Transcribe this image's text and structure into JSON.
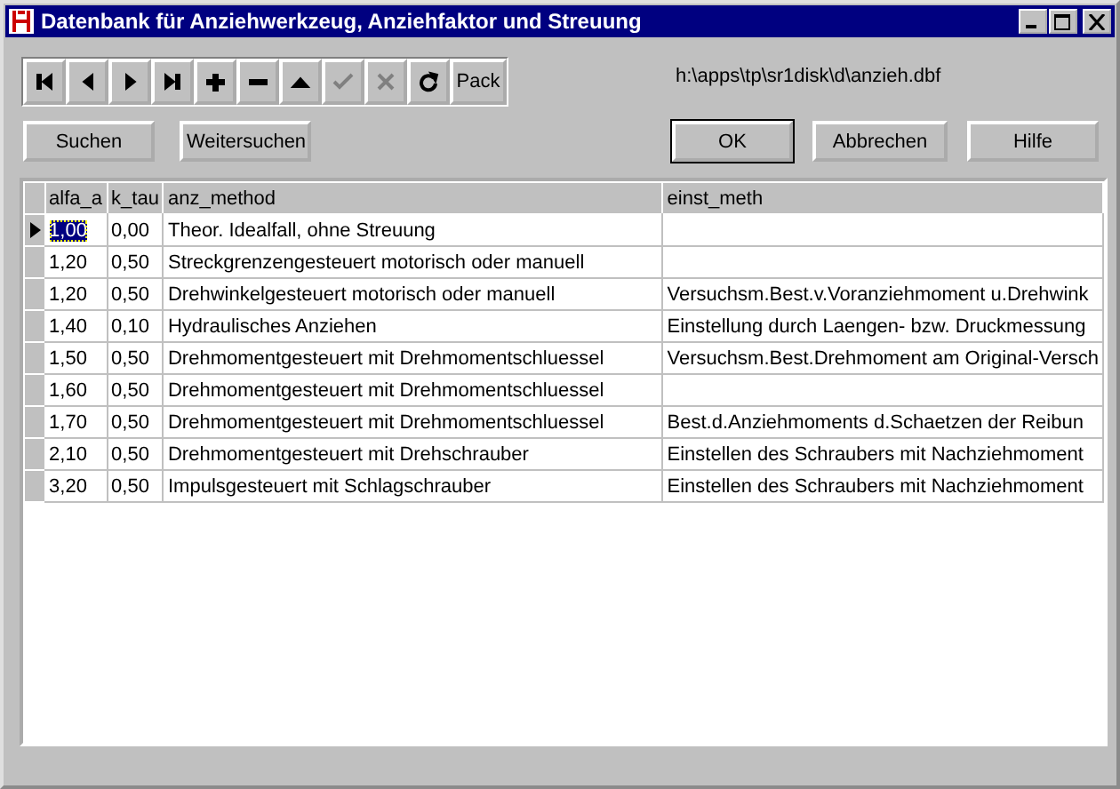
{
  "window": {
    "title": "Datenbank für Anziehwerkzeug, Anziehfaktor und Streuung"
  },
  "navigator": [
    {
      "kind": "first",
      "disabled": false
    },
    {
      "kind": "prior",
      "disabled": false
    },
    {
      "kind": "next",
      "disabled": false
    },
    {
      "kind": "last",
      "disabled": false
    },
    {
      "kind": "insert",
      "disabled": false
    },
    {
      "kind": "delete",
      "disabled": false
    },
    {
      "kind": "edit",
      "disabled": false
    },
    {
      "kind": "post",
      "disabled": true
    },
    {
      "kind": "cancel",
      "disabled": true
    },
    {
      "kind": "refresh",
      "disabled": false
    },
    {
      "kind": "text",
      "label": "Pack",
      "disabled": false
    }
  ],
  "file_path": "h:\\apps\\tp\\sr1disk\\d\\anzieh.dbf",
  "left_buttons": [
    {
      "label": "Suchen",
      "default": false
    },
    {
      "label": "Weitersuchen",
      "default": false
    }
  ],
  "right_buttons": [
    {
      "label": "OK",
      "default": true
    },
    {
      "label": "Abbrechen",
      "default": false
    },
    {
      "label": "Hilfe",
      "default": false
    }
  ],
  "table": {
    "columns": [
      "alfa_a",
      "k_tau",
      "anz_method",
      "einst_meth"
    ],
    "rows": [
      {
        "selected": true,
        "cells": [
          "1,00",
          "0,00",
          "Theor. Idealfall, ohne Streuung",
          ""
        ]
      },
      {
        "selected": false,
        "cells": [
          "1,20",
          "0,50",
          "Streckgrenzengesteuert motorisch oder manuell",
          ""
        ]
      },
      {
        "selected": false,
        "cells": [
          "1,20",
          "0,50",
          "Drehwinkelgesteuert motorisch oder manuell",
          "Versuchsm.Best.v.Voranziehmoment u.Drehwink"
        ]
      },
      {
        "selected": false,
        "cells": [
          "1,40",
          "0,10",
          "Hydraulisches Anziehen",
          "Einstellung durch Laengen- bzw. Druckmessung"
        ]
      },
      {
        "selected": false,
        "cells": [
          "1,50",
          "0,50",
          "Drehmomentgesteuert mit Drehmomentschluessel",
          "Versuchsm.Best.Drehmoment am Original-Versch"
        ]
      },
      {
        "selected": false,
        "cells": [
          "1,60",
          "0,50",
          "Drehmomentgesteuert mit Drehmomentschluessel",
          ""
        ]
      },
      {
        "selected": false,
        "cells": [
          "1,70",
          "0,50",
          "Drehmomentgesteuert mit Drehmomentschluessel",
          "Best.d.Anziehmoments d.Schaetzen der Reibun"
        ]
      },
      {
        "selected": false,
        "cells": [
          "2,10",
          "0,50",
          "Drehmomentgesteuert mit Drehschrauber",
          "Einstellen des Schraubers mit Nachziehmoment"
        ]
      },
      {
        "selected": false,
        "cells": [
          "3,20",
          "0,50",
          "Impulsgesteuert mit Schlagschrauber",
          "Einstellen des Schraubers mit Nachziehmoment"
        ]
      }
    ]
  }
}
